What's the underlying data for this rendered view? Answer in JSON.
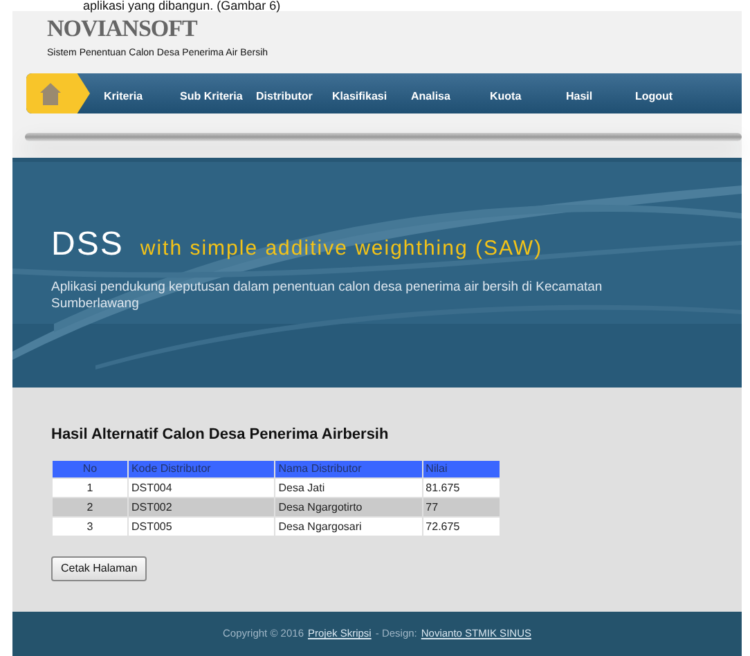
{
  "caption": "aplikasi yang dibangun. (Gambar 6)",
  "header": {
    "logo": "NOVIANSOFT",
    "subtitle": "Sistem Penentuan Calon Desa Penerima Air Bersih"
  },
  "nav": [
    {
      "label": "Kriteria"
    },
    {
      "label": "Sub Kriteria"
    },
    {
      "label": "Distributor"
    },
    {
      "label": "Klasifikasi"
    },
    {
      "label": "Analisa"
    },
    {
      "label": "Kuota"
    },
    {
      "label": "Hasil"
    },
    {
      "label": "Logout"
    }
  ],
  "banner": {
    "title": "DSS",
    "tagline": "with simple additive weighthing (SAW)",
    "description": "Aplikasi pendukung keputusan dalam penentuan calon desa penerima air bersih di Kecamatan Sumberlawang"
  },
  "content": {
    "heading": "Hasil Alternatif Calon Desa Penerima Airbersih",
    "table": {
      "columns": [
        "No",
        "Kode Distributor",
        "Nama Distributor",
        "Nilai"
      ],
      "rows": [
        [
          "1",
          "DST004",
          "Desa Jati",
          "81.675"
        ],
        [
          "2",
          "DST002",
          "Desa Ngargotirto",
          "77"
        ],
        [
          "3",
          "DST005",
          "Desa Ngargosari",
          "72.675"
        ]
      ]
    },
    "button": "Cetak Halaman"
  },
  "footer": {
    "parts": [
      {
        "kind": "text",
        "text": "Copyright © 2016"
      },
      {
        "kind": "link",
        "text": "Projek Skripsi"
      },
      {
        "kind": "text",
        "text": "- Design:"
      },
      {
        "kind": "link",
        "text": "Novianto STMIK SINUS"
      }
    ]
  }
}
